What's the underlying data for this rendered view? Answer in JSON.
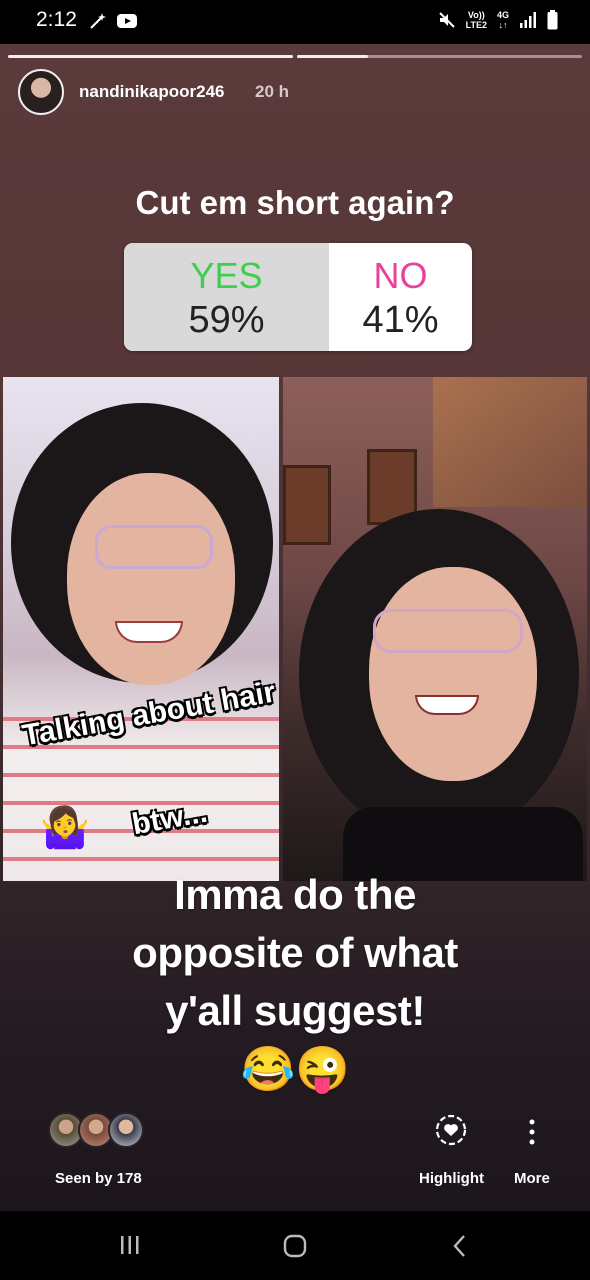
{
  "status_bar": {
    "time": "2:12",
    "network_top": "Vo))",
    "network_bottom": "LTE2",
    "network_gen": "4G"
  },
  "story": {
    "username": "nandinikapoor246",
    "time_ago": "20 h",
    "progress": {
      "segments": 2,
      "current_segment_fill": 0.25
    },
    "poll": {
      "question": "Cut em short again?",
      "options": [
        {
          "label": "YES",
          "percent": "59%",
          "value": 59,
          "color": "#3fcf4e"
        },
        {
          "label": "NO",
          "percent": "41%",
          "value": 41,
          "color": "#e8439a"
        }
      ]
    },
    "stickers": {
      "line1": "Talking about hair",
      "line2": "btw...",
      "emoji": "🤷‍♀️"
    },
    "caption": {
      "line1": "Imma do the",
      "line2": "opposite of what",
      "line3": "y'all suggest!",
      "emojis": "😂😜"
    }
  },
  "footer": {
    "seen_by": "Seen by 178",
    "highlight_label": "Highlight",
    "more_label": "More"
  },
  "nav": {
    "recents_icon": "recents-icon",
    "home_icon": "home-icon",
    "back_icon": "back-icon"
  }
}
